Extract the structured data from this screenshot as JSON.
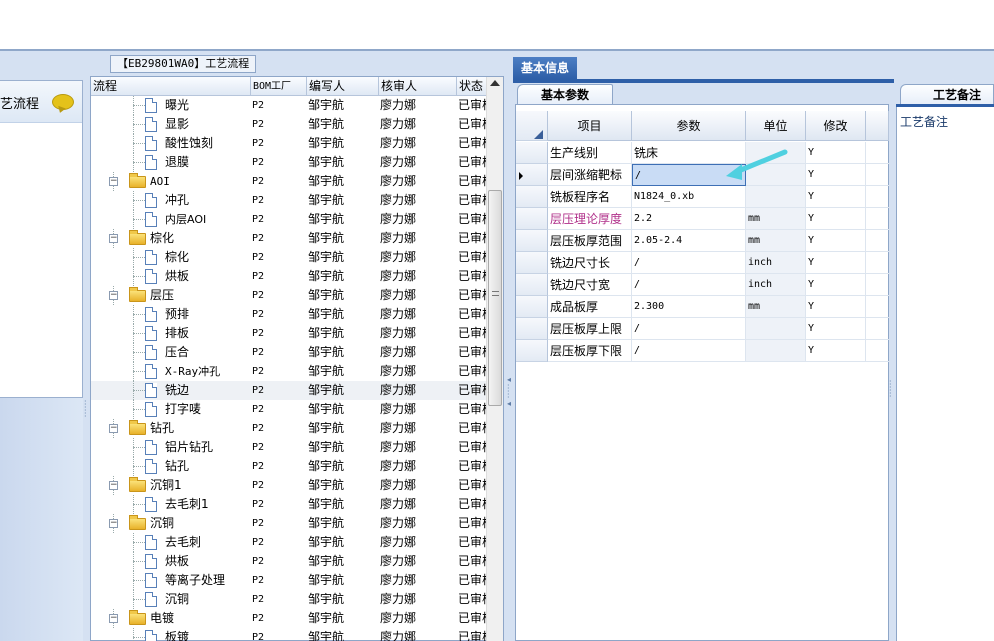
{
  "left_panel": {
    "title_partial": "艺流程"
  },
  "flow": {
    "panel_title": "【EB29801WA0】工艺流程",
    "headers": [
      "流程",
      "BOM工厂",
      "编写人",
      "核审人",
      "状态"
    ],
    "rows": [
      {
        "name": "曝光",
        "type": "doc",
        "level": 2,
        "bom": "P2",
        "writer": "邹宇航",
        "reviewer": "廖力娜",
        "status": "已审核"
      },
      {
        "name": "显影",
        "type": "doc",
        "level": 2,
        "bom": "P2",
        "writer": "邹宇航",
        "reviewer": "廖力娜",
        "status": "已审核"
      },
      {
        "name": "酸性蚀刻",
        "type": "doc",
        "level": 2,
        "bom": "P2",
        "writer": "邹宇航",
        "reviewer": "廖力娜",
        "status": "已审核"
      },
      {
        "name": "退膜",
        "type": "doc",
        "level": 2,
        "bom": "P2",
        "writer": "邹宇航",
        "reviewer": "廖力娜",
        "status": "已审核"
      },
      {
        "name": "AOI",
        "type": "folder",
        "level": 1,
        "bom": "P2",
        "writer": "邹宇航",
        "reviewer": "廖力娜",
        "status": "已审核"
      },
      {
        "name": "冲孔",
        "type": "doc",
        "level": 2,
        "bom": "P2",
        "writer": "邹宇航",
        "reviewer": "廖力娜",
        "status": "已审核"
      },
      {
        "name": "内层AOI",
        "type": "doc",
        "level": 2,
        "bom": "P2",
        "writer": "邹宇航",
        "reviewer": "廖力娜",
        "status": "已审核"
      },
      {
        "name": "棕化",
        "type": "folder",
        "level": 1,
        "bom": "P2",
        "writer": "邹宇航",
        "reviewer": "廖力娜",
        "status": "已审核"
      },
      {
        "name": "棕化",
        "type": "doc",
        "level": 2,
        "bom": "P2",
        "writer": "邹宇航",
        "reviewer": "廖力娜",
        "status": "已审核"
      },
      {
        "name": "烘板",
        "type": "doc",
        "level": 2,
        "bom": "P2",
        "writer": "邹宇航",
        "reviewer": "廖力娜",
        "status": "已审核"
      },
      {
        "name": "层压",
        "type": "folder",
        "level": 1,
        "bom": "P2",
        "writer": "邹宇航",
        "reviewer": "廖力娜",
        "status": "已审核"
      },
      {
        "name": "预排",
        "type": "doc",
        "level": 2,
        "bom": "P2",
        "writer": "邹宇航",
        "reviewer": "廖力娜",
        "status": "已审核"
      },
      {
        "name": "排板",
        "type": "doc",
        "level": 2,
        "bom": "P2",
        "writer": "邹宇航",
        "reviewer": "廖力娜",
        "status": "已审核"
      },
      {
        "name": "压合",
        "type": "doc",
        "level": 2,
        "bom": "P2",
        "writer": "邹宇航",
        "reviewer": "廖力娜",
        "status": "已审核"
      },
      {
        "name": "X-Ray冲孔",
        "type": "doc",
        "level": 2,
        "bom": "P2",
        "writer": "邹宇航",
        "reviewer": "廖力娜",
        "status": "已审核"
      },
      {
        "name": "铣边",
        "type": "doc",
        "level": 2,
        "bom": "P2",
        "writer": "邹宇航",
        "reviewer": "廖力娜",
        "status": "已审核",
        "selected": true
      },
      {
        "name": "打字唛",
        "type": "doc",
        "level": 2,
        "bom": "P2",
        "writer": "邹宇航",
        "reviewer": "廖力娜",
        "status": "已审核"
      },
      {
        "name": "钻孔",
        "type": "folder",
        "level": 1,
        "bom": "P2",
        "writer": "邹宇航",
        "reviewer": "廖力娜",
        "status": "已审核"
      },
      {
        "name": "铝片钻孔",
        "type": "doc",
        "level": 2,
        "bom": "P2",
        "writer": "邹宇航",
        "reviewer": "廖力娜",
        "status": "已审核"
      },
      {
        "name": "钻孔",
        "type": "doc",
        "level": 2,
        "bom": "P2",
        "writer": "邹宇航",
        "reviewer": "廖力娜",
        "status": "已审核"
      },
      {
        "name": "沉铜1",
        "type": "folder",
        "level": 1,
        "bom": "P2",
        "writer": "邹宇航",
        "reviewer": "廖力娜",
        "status": "已审核"
      },
      {
        "name": "去毛刺1",
        "type": "doc",
        "level": 2,
        "bom": "P2",
        "writer": "邹宇航",
        "reviewer": "廖力娜",
        "status": "已审核"
      },
      {
        "name": "沉铜",
        "type": "folder",
        "level": 1,
        "bom": "P2",
        "writer": "邹宇航",
        "reviewer": "廖力娜",
        "status": "已审核"
      },
      {
        "name": "去毛刺",
        "type": "doc",
        "level": 2,
        "bom": "P2",
        "writer": "邹宇航",
        "reviewer": "廖力娜",
        "status": "已审核"
      },
      {
        "name": "烘板",
        "type": "doc",
        "level": 2,
        "bom": "P2",
        "writer": "邹宇航",
        "reviewer": "廖力娜",
        "status": "已审核"
      },
      {
        "name": "等离子处理",
        "type": "doc",
        "level": 2,
        "bom": "P2",
        "writer": "邹宇航",
        "reviewer": "廖力娜",
        "status": "已审核"
      },
      {
        "name": "沉铜",
        "type": "doc",
        "level": 2,
        "bom": "P2",
        "writer": "邹宇航",
        "reviewer": "廖力娜",
        "status": "已审核"
      },
      {
        "name": "电镀",
        "type": "folder",
        "level": 1,
        "bom": "P2",
        "writer": "邹宇航",
        "reviewer": "廖力娜",
        "status": "已审核"
      },
      {
        "name": "板镀",
        "type": "doc",
        "level": 2,
        "bom": "P2",
        "writer": "邹宇航",
        "reviewer": "廖力娜",
        "status": "已审核"
      }
    ]
  },
  "basic_info": {
    "tab": "基本信息",
    "subtab": "基本参数",
    "headers": [
      "项目",
      "参数",
      "单位",
      "修改"
    ],
    "rows": [
      {
        "item": "生产线别",
        "param": "铣床",
        "unit": "",
        "mod": "Y"
      },
      {
        "item": "层间涨缩靶标",
        "param": "/",
        "unit": "",
        "mod": "Y",
        "current": true
      },
      {
        "item": "铣板程序名",
        "param": "N1824_0.xb",
        "unit": "",
        "mod": "Y"
      },
      {
        "item": "层压理论厚度",
        "param": "2.2",
        "unit": "mm",
        "mod": "Y",
        "highlight": true
      },
      {
        "item": "层压板厚范围",
        "param": "2.05-2.4",
        "unit": "mm",
        "mod": "Y"
      },
      {
        "item": "铣边尺寸长",
        "param": "/",
        "unit": "inch",
        "mod": "Y"
      },
      {
        "item": "铣边尺寸宽",
        "param": "/",
        "unit": "inch",
        "mod": "Y"
      },
      {
        "item": "成品板厚",
        "param": "2.300",
        "unit": "mm",
        "mod": "Y"
      },
      {
        "item": "层压板厚上限",
        "param": "/",
        "unit": "",
        "mod": "Y"
      },
      {
        "item": "层压板厚下限",
        "param": "/",
        "unit": "",
        "mod": "Y"
      }
    ]
  },
  "remarks": {
    "tab": "工艺备注",
    "label": "工艺备注"
  },
  "colors": {
    "accent": "#2e5fa8",
    "highlight_text": "#b0308a",
    "folder": "#e8b22a"
  }
}
